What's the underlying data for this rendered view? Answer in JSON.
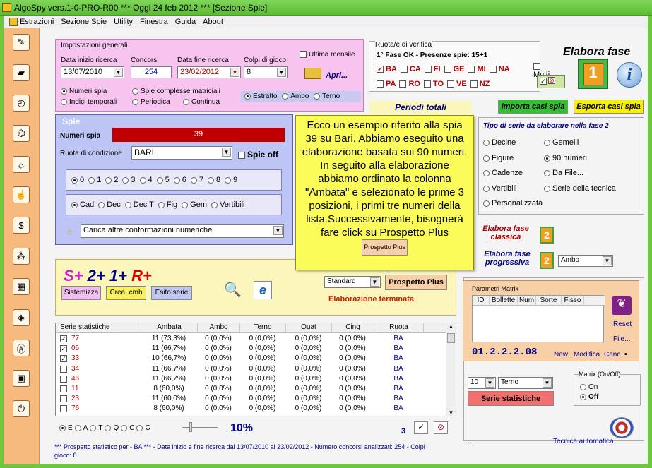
{
  "app": {
    "title": "AlgoSpy vers.1-0-PRO-R00  ***  Oggi 24 feb 2012  ***   [Sezione Spie]"
  },
  "menu": [
    "Estrazioni",
    "Sezione Spie",
    "Utility",
    "Finestra",
    "Guida",
    "About"
  ],
  "impostazioni": {
    "title": "Impostazioni generali",
    "data_inizio_label": "Data inizio ricerca",
    "data_inizio": "13/07/2010",
    "concorsi_label": "Concorsi",
    "concorsi": "254",
    "data_fine_label": "Data fine ricerca",
    "data_fine": "23/02/2012",
    "colpi_label": "Colpi di gioco",
    "colpi": "8",
    "ultima_mensile": "Ultima mensile",
    "apri": "Apri...",
    "numeri_spia": "Numeri spia",
    "indici_temporali": "Indici temporali",
    "spie_complesse": "Spie complesse matriciali",
    "periodica": "Periodica",
    "continua": "Continua",
    "estratto": "Estratto",
    "ambo": "Ambo",
    "terno": "Terno"
  },
  "spie": {
    "title": "Spie",
    "numeri_spia_label": "Numeri spia",
    "numeri_spia_value": "39",
    "ruota_label": "Ruota di condizione",
    "ruota_value": "BARI",
    "spie_off": "Spie off",
    "digits": [
      "0",
      "1",
      "2",
      "3",
      "4",
      "5",
      "6",
      "7",
      "8",
      "9"
    ],
    "types": [
      "Cad",
      "Dec",
      "Dec T",
      "Fig",
      "Gem",
      "Vertibili"
    ],
    "carica": "Carica altre conformazioni numeriche"
  },
  "ruote": {
    "title": "Ruota/e di verifica",
    "fase": "1° Fase OK - Presenze spie: 15+1",
    "row1": [
      "BA",
      "CA",
      "FI",
      "GE",
      "MI",
      "NA"
    ],
    "row2": [
      "PA",
      "RO",
      "TO",
      "VE",
      "NZ"
    ],
    "multi": "Multi"
  },
  "elabora": {
    "title": "Elabora fase",
    "periodi_totali": "Periodi totali",
    "importa": "Importa casi spia",
    "esporta": "Esporta casi spia"
  },
  "tooltip": {
    "text": "Ecco un esempio riferito alla spia 39 su Bari. Abbiamo eseguito una elaborazione basata sui 90 numeri. In seguito alla elaborazione abbiamo ordinato la colonna \"Ambata\" e selezionato le prime 3 posizioni, i primi tre numeri della lista.Successivamente, bisognerà fare click su Prospetto Plus",
    "button": "Prospetto Plus"
  },
  "tiposerie": {
    "title": "Tipo di serie da elaborare nella fase 2",
    "options": [
      "Decine",
      "Gemelli",
      "Figure",
      "90 numeri",
      "Cadenze",
      "Da File...",
      "Vertibili",
      "Serie della tecnica",
      "Personalizzata"
    ],
    "classica": "Elabora fase classica",
    "progressiva": "Elabora fase progressiva",
    "ambo": "Ambo"
  },
  "splus": {
    "sistemizza": "Sistemizza",
    "crea": "Crea .cmb",
    "esito": "Esito serie",
    "standard": "Standard",
    "prospetto": "Prospetto Plus",
    "terminata": "Elaborazione terminata"
  },
  "table": {
    "headers": [
      "Serie statistiche",
      "Ambata",
      "Ambo",
      "Terno",
      "Quat",
      "Cinq",
      "Ruota"
    ],
    "rows": [
      [
        "77",
        "11 (73,3%)",
        "0 (0,0%)",
        "0 (0,0%)",
        "0 (0,0%)",
        "0 (0,0%)",
        "BA",
        true
      ],
      [
        "05",
        "11 (66,7%)",
        "0 (0,0%)",
        "0 (0,0%)",
        "0 (0,0%)",
        "0 (0,0%)",
        "BA",
        true
      ],
      [
        "33",
        "10 (66,7%)",
        "0 (0,0%)",
        "0 (0,0%)",
        "0 (0,0%)",
        "0 (0,0%)",
        "BA",
        true
      ],
      [
        "34",
        "11 (66,7%)",
        "0 (0,0%)",
        "0 (0,0%)",
        "0 (0,0%)",
        "0 (0,0%)",
        "BA",
        false
      ],
      [
        "46",
        "11 (66,7%)",
        "0 (0,0%)",
        "0 (0,0%)",
        "0 (0,0%)",
        "0 (0,0%)",
        "BA",
        false
      ],
      [
        "11",
        "8 (60,0%)",
        "0 (0,0%)",
        "0 (0,0%)",
        "0 (0,0%)",
        "0 (0,0%)",
        "BA",
        false
      ],
      [
        "23",
        "11 (60,0%)",
        "0 (0,0%)",
        "0 (0,0%)",
        "0 (0,0%)",
        "0 (0,0%)",
        "BA",
        false
      ],
      [
        "76",
        "8 (60,0%)",
        "0 (0,0%)",
        "0 (0,0%)",
        "0 (0,0%)",
        "0 (0,0%)",
        "BA",
        false
      ]
    ]
  },
  "matrix": {
    "title": "Parametri Matrix",
    "headers": [
      "ID",
      "Bollette",
      "Num",
      "Sorte",
      "Fisso"
    ],
    "code": "01.2.2.2.08",
    "new": "New",
    "modifica": "Modifica",
    "canc": "Canc",
    "reset": "Reset",
    "file": "File...",
    "onoff": "Matrix (On/Off)",
    "on": "On",
    "off": "Off"
  },
  "bottom": {
    "sel10": "10",
    "terno": "Terno",
    "serie_stat": "Serie statistiche",
    "tecnica": "Tecnica automatica",
    "radios": [
      "E",
      "A",
      "T",
      "Q",
      "C",
      "C"
    ],
    "percent": "10%",
    "count": "3",
    "status": "*** Prospetto statistico per  - BA *** - Data inizio e fine ricerca dal 13/07/2010 al 23/02/2012 - Numero concorsi analizzati: 254 - Colpi",
    "status2": "gioco: 8",
    "dots": "..."
  }
}
